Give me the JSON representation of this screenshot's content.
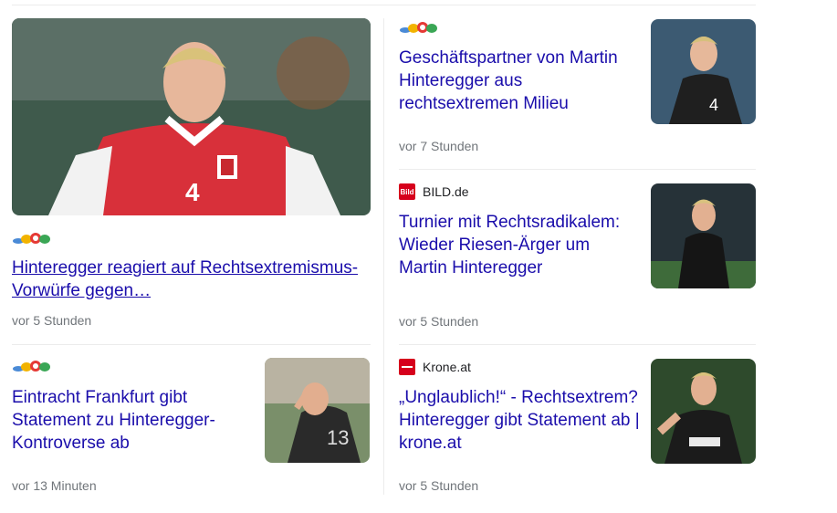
{
  "colors": {
    "link": "#1a0dab",
    "meta": "#70757a",
    "divider": "#ececec",
    "bild": "#d6001c",
    "krone": "#d6001c"
  },
  "articles": [
    {
      "source": "oe24.at",
      "source_logo_text": "oe24.at",
      "title": "Hinteregger reagiert auf Rechtsextremismus-Vorwürfe gegen…",
      "time": "vor 5 Stunden",
      "thumb": "player-red-jersey-4"
    },
    {
      "source": "oe24.at",
      "source_logo_text": "oe24.at",
      "title": "Geschäftspartner von Martin Hinteregger aus rechtsextremen Milieu",
      "time": "vor 7 Stunden",
      "thumb": "player-black-jersey-4"
    },
    {
      "source": "BILD.de",
      "source_icon_text": "Bild",
      "title": "Turnier mit Rechtsradikalem: Wieder Riesen-Ärger um Martin Hinteregger",
      "time": "vor 5 Stunden",
      "thumb": "player-black-jersey-frankfurt"
    },
    {
      "source": "oe24.at",
      "source_logo_text": "oe24.at",
      "title": "Eintracht Frankfurt gibt Statement zu Hinteregger-Kontroverse ab",
      "time": "vor 13 Minuten",
      "thumb": "player-head-down-13"
    },
    {
      "source": "Krone.at",
      "title": "„Unglaublich!“ - Rechtsextrem? Hinteregger gibt Statement ab | krone.at",
      "time": "vor 5 Stunden",
      "thumb": "player-black-jersey-indeed"
    }
  ]
}
